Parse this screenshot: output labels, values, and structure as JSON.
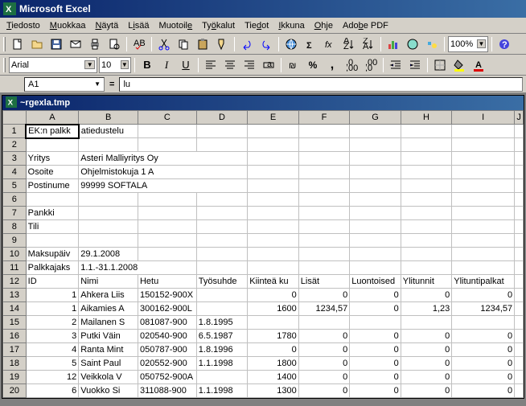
{
  "app": {
    "title": "Microsoft Excel"
  },
  "menu": {
    "tiedosto": "Tiedosto",
    "muokkaa": "Muokkaa",
    "nayta": "Näytä",
    "lisaa": "Lisää",
    "muotoile": "Muotoile",
    "tyokalut": "Työkalut",
    "tiedot": "Tiedot",
    "ikkuna": "Ikkuna",
    "ohje": "Ohje",
    "adobe": "Adobe PDF"
  },
  "format": {
    "font": "Arial",
    "size": "10",
    "zoom": "100%"
  },
  "namebox": "A1",
  "formula": "lu",
  "doc": {
    "title": "~rgexla.tmp"
  },
  "cols": [
    "A",
    "B",
    "C",
    "D",
    "E",
    "F",
    "G",
    "H",
    "I",
    "J"
  ],
  "cells": {
    "A1": "EK:n palkk",
    "B1_overflow": "atiedustelu",
    "A3": "Yritys",
    "B3": "Asteri Malliyritys Oy",
    "A4": "Osoite",
    "B4": "Ohjelmistokuja 1 A",
    "A5": "Postinume",
    "B5": "99999 SOFTALA",
    "A7": "Pankki",
    "A8": "Tili",
    "A10": "Maksupäiv",
    "B10": "29.1.2008",
    "A11": "Palkkajaks",
    "B11": "1.1.-31.1.2008",
    "A12": "ID",
    "B12": "Nimi",
    "C12": "Hetu",
    "D12": "Työsuhde",
    "E12": "Kiinteä ku",
    "F12": "Lisät",
    "G12": "Luontoised",
    "H12": "Ylitunnit",
    "I12": "Ylituntipalkat"
  },
  "rows": [
    {
      "n": 13,
      "id": "1",
      "nimi": "Ahkera Liis",
      "hetu": "150152-900X",
      "ty": "",
      "kk": "0",
      "li": "0",
      "lu": "0",
      "yt": "0",
      "yp": "0"
    },
    {
      "n": 14,
      "id": "1",
      "nimi": "Aikamies A",
      "hetu": "300162-900L",
      "ty": "",
      "kk": "1600",
      "li": "1234,57",
      "lu": "0",
      "yt": "1,23",
      "yp": "1234,57"
    },
    {
      "n": 15,
      "id": "2",
      "nimi": "Mailanen S",
      "hetu": "081087-900",
      "ty": "1.8.1995",
      "kk": "",
      "li": "",
      "lu": "",
      "yt": "",
      "yp": ""
    },
    {
      "n": 16,
      "id": "3",
      "nimi": "Putki Väin",
      "hetu": "020540-900",
      "ty": "6.5.1987",
      "kk": "1780",
      "li": "0",
      "lu": "0",
      "yt": "0",
      "yp": "0"
    },
    {
      "n": 17,
      "id": "4",
      "nimi": "Ranta Mint",
      "hetu": "050787-900",
      "ty": "1.8.1996",
      "kk": "0",
      "li": "0",
      "lu": "0",
      "yt": "0",
      "yp": "0"
    },
    {
      "n": 18,
      "id": "5",
      "nimi": "Saint Paul",
      "hetu": "020552-900",
      "ty": "1.1.1998",
      "kk": "1800",
      "li": "0",
      "lu": "0",
      "yt": "0",
      "yp": "0"
    },
    {
      "n": 19,
      "id": "12",
      "nimi": "Veikkola V",
      "hetu": "050752-900A",
      "ty": "",
      "kk": "1400",
      "li": "0",
      "lu": "0",
      "yt": "0",
      "yp": "0"
    },
    {
      "n": 20,
      "id": "6",
      "nimi": "Vuokko Si",
      "hetu": "311088-900",
      "ty": "1.1.1998",
      "kk": "1300",
      "li": "0",
      "lu": "0",
      "yt": "0",
      "yp": "0"
    }
  ],
  "chart_data": {
    "type": "table",
    "title": "EK:n palkkatiedustelu",
    "columns": [
      "ID",
      "Nimi",
      "Hetu",
      "Työsuhde",
      "Kiinteä kuukausipalkka",
      "Lisät",
      "Luontoisedut",
      "Ylitunnit",
      "Ylituntipalkat"
    ],
    "records": [
      {
        "ID": 1,
        "Nimi": "Ahkera Liisa",
        "Hetu": "150152-900X",
        "Työsuhde": "",
        "Kiinteä": 0,
        "Lisät": 0,
        "Luontoisedut": 0,
        "Ylitunnit": 0,
        "Ylituntipalkat": 0
      },
      {
        "ID": 1,
        "Nimi": "Aikamies A",
        "Hetu": "300162-900L",
        "Työsuhde": "",
        "Kiinteä": 1600,
        "Lisät": 1234.57,
        "Luontoisedut": 0,
        "Ylitunnit": 1.23,
        "Ylituntipalkat": 1234.57
      },
      {
        "ID": 2,
        "Nimi": "Mailanen S",
        "Hetu": "081087-900",
        "Työsuhde": "1.8.1995",
        "Kiinteä": null,
        "Lisät": null,
        "Luontoisedut": null,
        "Ylitunnit": null,
        "Ylituntipalkat": null
      },
      {
        "ID": 3,
        "Nimi": "Putki Väinö",
        "Hetu": "020540-900",
        "Työsuhde": "6.5.1987",
        "Kiinteä": 1780,
        "Lisät": 0,
        "Luontoisedut": 0,
        "Ylitunnit": 0,
        "Ylituntipalkat": 0
      },
      {
        "ID": 4,
        "Nimi": "Ranta Minttu",
        "Hetu": "050787-900",
        "Työsuhde": "1.8.1996",
        "Kiinteä": 0,
        "Lisät": 0,
        "Luontoisedut": 0,
        "Ylitunnit": 0,
        "Ylituntipalkat": 0
      },
      {
        "ID": 5,
        "Nimi": "Saint Paul",
        "Hetu": "020552-900",
        "Työsuhde": "1.1.1998",
        "Kiinteä": 1800,
        "Lisät": 0,
        "Luontoisedut": 0,
        "Ylitunnit": 0,
        "Ylituntipalkat": 0
      },
      {
        "ID": 12,
        "Nimi": "Veikkola V",
        "Hetu": "050752-900A",
        "Työsuhde": "",
        "Kiinteä": 1400,
        "Lisät": 0,
        "Luontoisedut": 0,
        "Ylitunnit": 0,
        "Ylituntipalkat": 0
      },
      {
        "ID": 6,
        "Nimi": "Vuokko Si",
        "Hetu": "311088-900",
        "Työsuhde": "1.1.1998",
        "Kiinteä": 1300,
        "Lisät": 0,
        "Luontoisedut": 0,
        "Ylitunnit": 0,
        "Ylituntipalkat": 0
      }
    ]
  }
}
